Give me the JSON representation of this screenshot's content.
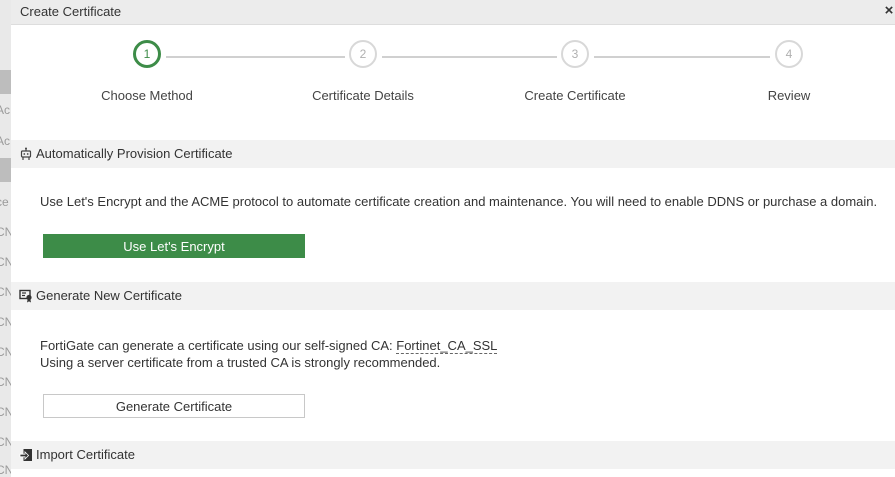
{
  "background": {
    "fragments": [
      "Ac",
      "Ac",
      "ce",
      "CN",
      "CN",
      "CN",
      "CN",
      "CN",
      "CN",
      "CN",
      "CN",
      "CN"
    ]
  },
  "dialog": {
    "title": "Create Certificate",
    "close_glyph": "×"
  },
  "stepper": {
    "steps": [
      {
        "number": "1",
        "label": "Choose Method",
        "active": true
      },
      {
        "number": "2",
        "label": "Certificate Details",
        "active": false
      },
      {
        "number": "3",
        "label": "Create Certificate",
        "active": false
      },
      {
        "number": "4",
        "label": "Review",
        "active": false
      }
    ]
  },
  "sections": {
    "auto": {
      "title": "Automatically Provision Certificate",
      "icon": "robot-icon",
      "description": "Use Let's Encrypt and the ACME protocol to automate certificate creation and maintenance. You will need to enable DDNS or purchase a domain.",
      "button_label": "Use Let's Encrypt"
    },
    "generate": {
      "title": "Generate New Certificate",
      "icon": "certificate-icon",
      "description_prefix": "FortiGate can generate a certificate using our self-signed CA: ",
      "ca_link": "Fortinet_CA_SSL",
      "description_line2": "Using a server certificate from a trusted CA is strongly recommended.",
      "button_label": "Generate Certificate"
    },
    "import": {
      "title": "Import Certificate",
      "icon": "import-icon"
    }
  },
  "colors": {
    "accent_green": "#3d8c48",
    "section_bg": "#f2f2f2",
    "titlebar_bg": "#ececec"
  }
}
